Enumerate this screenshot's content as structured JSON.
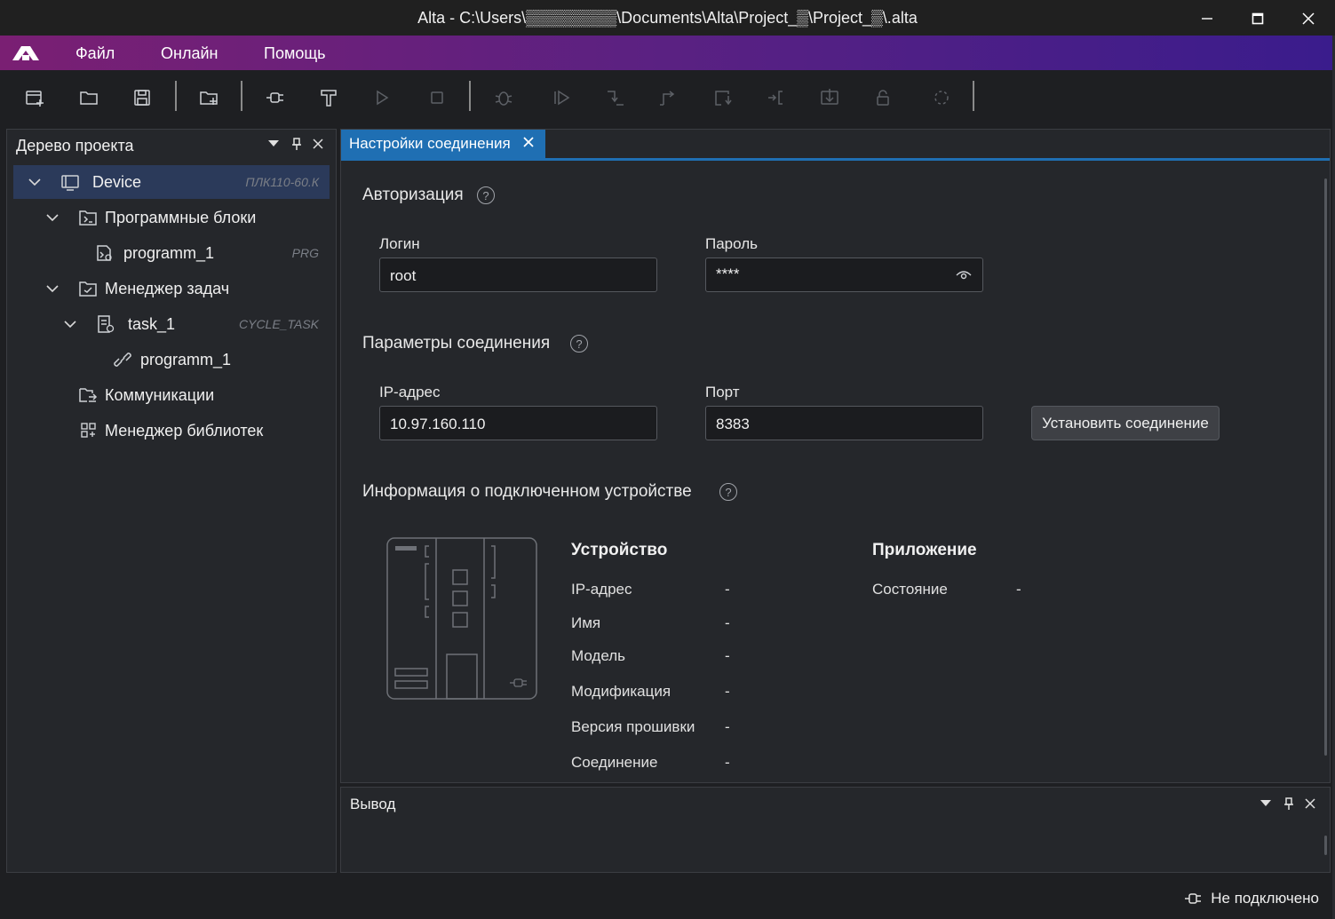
{
  "window": {
    "title": "Alta - C:\\Users\\▒▒▒▒▒▒▒▒\\Documents\\Alta\\Project_▒\\Project_▒\\.alta",
    "min": "—",
    "max": "☐",
    "close": "✕"
  },
  "menu": {
    "items": [
      "Файл",
      "Онлайн",
      "Помощь"
    ]
  },
  "toolbar": {
    "icons": [
      "new-project-icon",
      "open-folder-icon",
      "save-icon",
      "add-device-icon",
      "connect-plug-icon",
      "build-icon",
      "run-icon",
      "stop-icon",
      "debug-icon",
      "step-into-icon",
      "step-over-icon",
      "step-out-icon",
      "step-return-icon",
      "breakpoint-icon",
      "download-icon",
      "unlock-icon",
      "loading-icon"
    ]
  },
  "tree": {
    "title": "Дерево проекта",
    "rows": [
      {
        "label": "Device",
        "tag": "ПЛК110-60.К",
        "icon": "device-icon"
      },
      {
        "label": "Программные блоки",
        "tag": "",
        "icon": "program-blocks-icon"
      },
      {
        "label": "programm_1",
        "tag": "PRG",
        "icon": "program-icon"
      },
      {
        "label": "Менеджер задач",
        "tag": "",
        "icon": "task-manager-icon"
      },
      {
        "label": "task_1",
        "tag": "CYCLE_TASK",
        "icon": "task-icon"
      },
      {
        "label": "programm_1",
        "tag": "",
        "icon": "link-icon"
      },
      {
        "label": "Коммуникации",
        "tag": "",
        "icon": "communications-icon"
      },
      {
        "label": "Менеджер библиотек",
        "tag": "",
        "icon": "library-manager-icon"
      }
    ]
  },
  "editor": {
    "tab_label": "Настройки соединения",
    "auth": {
      "title": "Авторизация",
      "login_label": "Логин",
      "login_value": "root",
      "password_label": "Пароль",
      "password_value": "****"
    },
    "connection": {
      "title": "Параметры соединения",
      "ip_label": "IP-адрес",
      "ip_value": "10.97.160.110",
      "port_label": "Порт",
      "port_value": "8383",
      "connect_button": "Установить соединение"
    },
    "info": {
      "title": "Информация о подключенном устройстве",
      "device_heading": "Устройство",
      "app_heading": "Приложение",
      "device_fields": [
        {
          "label": "IP-адрес",
          "value": "-"
        },
        {
          "label": "Имя",
          "value": "-"
        },
        {
          "label": "Модель",
          "value": "-"
        },
        {
          "label": "Модификация",
          "value": "-"
        },
        {
          "label": "Версия прошивки",
          "value": "-"
        },
        {
          "label": "Соединение",
          "value": "-"
        }
      ],
      "app_fields": [
        {
          "label": "Состояние",
          "value": "-"
        }
      ]
    }
  },
  "output": {
    "title": "Вывод"
  },
  "status": {
    "text": "Не подключено"
  },
  "colors": {
    "accent": "#1f6fb3",
    "menu_gradient_start": "#7a1f73",
    "menu_gradient_end": "#3a1c8c",
    "background": "#1e1f22",
    "panel": "#25272b"
  }
}
